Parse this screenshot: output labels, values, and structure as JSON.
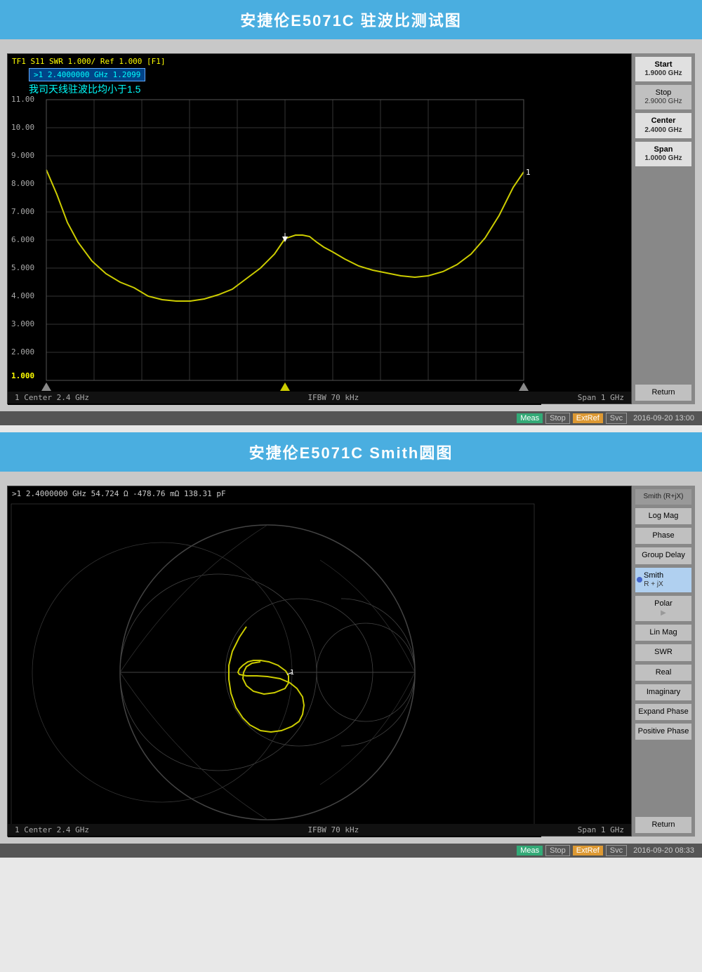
{
  "section1": {
    "title": "安捷伦E5071C  驻波比测试图",
    "chart_label": "TF1  S11  SWR 1.000/ Ref 1.000 [F1]",
    "marker": ">1  2.4000000 GHz  1.2099",
    "chinese_text": "我司天线驻波比均小于1.5",
    "y_labels": [
      "11.00",
      "10.00",
      "9.000",
      "8.000",
      "7.000",
      "6.000",
      "5.000",
      "4.000",
      "3.000",
      "2.000",
      "1.000"
    ],
    "bottom_left": "1  Center 2.4 GHz",
    "bottom_center": "IFBW 70 kHz",
    "bottom_right": "Span 1 GHz",
    "sidebar": {
      "buttons": [
        {
          "label": "Start",
          "sub": "1.9000 GHz"
        },
        {
          "label": "Stop",
          "sub": "2.9000 GHz"
        },
        {
          "label": "Center",
          "sub": "2.4000 GHz"
        },
        {
          "label": "Span",
          "sub": "1.0000 GHz"
        },
        {
          "label": "Return",
          "sub": ""
        }
      ]
    },
    "status": {
      "meas": "Meas",
      "stop": "Stop",
      "extref": "ExtRef",
      "svc": "Svc",
      "time": "2016-09-20 13:00"
    }
  },
  "section2": {
    "title": "安捷伦E5071C  Smith圆图",
    "chart_label": ">1  2.4000000 GHz  54.724 Ω  -478.76 mΩ  138.31 pF",
    "bottom_left": "1  Center 2.4 GHz",
    "bottom_center": "IFBW 70 kHz",
    "bottom_right": "Span 1 GHz",
    "sidebar": {
      "buttons": [
        {
          "label": "Smith (R+jX)",
          "sub": "",
          "top_label": true
        },
        {
          "label": "Log Mag",
          "sub": ""
        },
        {
          "label": "Phase",
          "sub": ""
        },
        {
          "label": "Group Delay",
          "sub": ""
        },
        {
          "label": "Smith",
          "sub": "R + jX",
          "selected": true
        },
        {
          "label": "Polar",
          "sub": ""
        },
        {
          "label": "Lin Mag",
          "sub": ""
        },
        {
          "label": "SWR",
          "sub": ""
        },
        {
          "label": "Real",
          "sub": ""
        },
        {
          "label": "Imaginary",
          "sub": ""
        },
        {
          "label": "Expand Phase",
          "sub": ""
        },
        {
          "label": "Positive Phase",
          "sub": ""
        },
        {
          "label": "Return",
          "sub": ""
        }
      ]
    },
    "status": {
      "meas": "Meas",
      "stop": "Stop",
      "extref": "ExtRef",
      "svc": "Svc",
      "time": "2016-09-20 08:33"
    }
  }
}
